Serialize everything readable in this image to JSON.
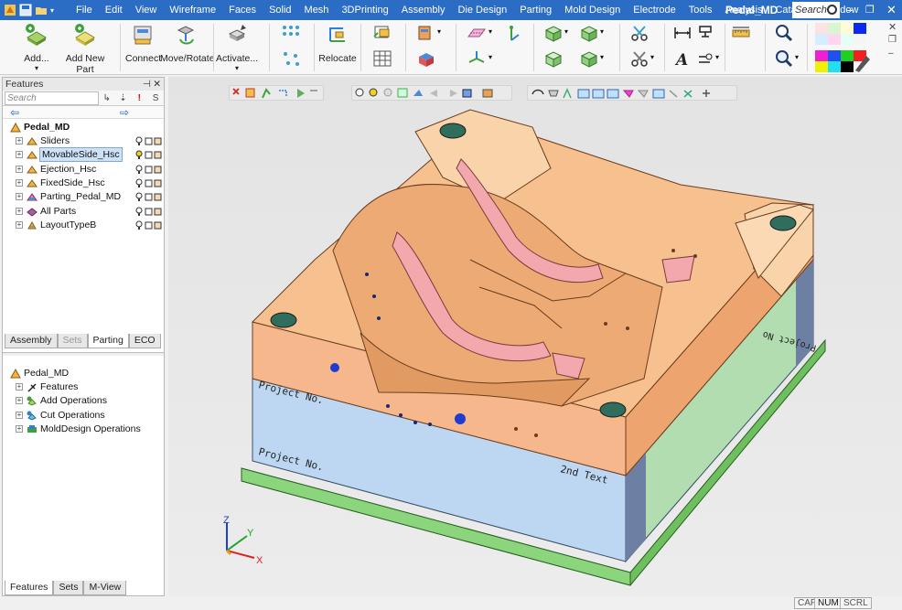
{
  "menubar": {
    "items": [
      "File",
      "Edit",
      "View",
      "Wireframe",
      "Faces",
      "Solid",
      "Mesh",
      "3DPrinting",
      "Assembly",
      "Die Design",
      "Parting",
      "Mold Design",
      "Electrode",
      "Tools",
      "Analysis",
      "Catalog",
      "Window"
    ],
    "doc_title": "Pedal_MD",
    "search_placeholder": "Search"
  },
  "ribbon": {
    "add_label": "Add...",
    "add_new_part_label": "Add New Part",
    "connect_label": "Connect",
    "move_rotate_label": "Move/Rotate",
    "activate_label": "Activate...",
    "relocate_label": "Relocate"
  },
  "features_panel": {
    "title": "Features",
    "search_placeholder": "Search",
    "root": "Pedal_MD",
    "items": [
      {
        "label": "Sliders",
        "icon": "assembly-icon"
      },
      {
        "label": "MovableSide_Hsc",
        "icon": "assembly-icon",
        "selected": true
      },
      {
        "label": "Ejection_Hsc",
        "icon": "assembly-icon"
      },
      {
        "label": "FixedSide_Hsc",
        "icon": "assembly-icon"
      },
      {
        "label": "Parting_Pedal_MD",
        "icon": "part-icon"
      },
      {
        "label": "All Parts",
        "icon": "all-parts-icon"
      },
      {
        "label": "LayoutTypeB",
        "icon": "layout-icon"
      }
    ],
    "tabs": [
      {
        "label": "Assembly",
        "state": "normal"
      },
      {
        "label": "Sets",
        "state": "dim"
      },
      {
        "label": "Parting",
        "state": "active"
      },
      {
        "label": "ECO",
        "state": "normal"
      }
    ]
  },
  "history_panel": {
    "root": "Pedal_MD",
    "items": [
      "Features",
      "Add Operations",
      "Cut Operations",
      "MoldDesign Operations"
    ],
    "tabs": [
      {
        "label": "Features",
        "state": "active"
      },
      {
        "label": "Sets",
        "state": "normal"
      },
      {
        "label": "M-View",
        "state": "normal"
      }
    ]
  },
  "viewport": {
    "engravings": [
      "Project No.",
      "Project No.",
      "2nd Text",
      "Project No"
    ],
    "axis": {
      "x": "X",
      "y": "Y",
      "z": "Z"
    }
  },
  "statusbar": {
    "indicators": [
      {
        "label": "CAP",
        "on": false
      },
      {
        "label": "NUM",
        "on": true
      },
      {
        "label": "SCRL",
        "on": false
      }
    ]
  },
  "colors": {
    "title_bar": "#2b6cc4",
    "mold_plate": "#f3b27b",
    "base_plate": "#b9d4ef",
    "bottom_plate": "#86d47a",
    "part": "#f0a3a8"
  }
}
